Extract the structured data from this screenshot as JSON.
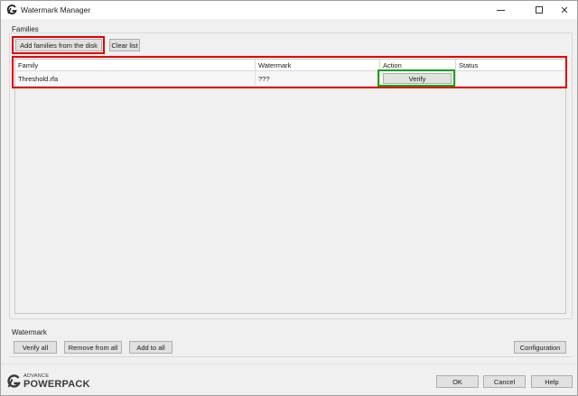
{
  "window": {
    "title": "Watermark Manager",
    "minimize_icon": "minimize-icon",
    "maximize_icon": "maximize-icon",
    "close_icon": "close-icon",
    "close_glyph": "✕"
  },
  "families": {
    "group_label": "Families",
    "add_button": "Add families from the disk",
    "clear_button": "Clear list",
    "table": {
      "columns": [
        "Family",
        "Watermark",
        "Action",
        "Status"
      ],
      "rows": [
        {
          "family": "Threshold.rfa",
          "watermark": "???",
          "action": "Verify",
          "status": ""
        }
      ]
    }
  },
  "watermark": {
    "group_label": "Watermark",
    "verify_all": "Verify all",
    "remove_from_all": "Remove from all",
    "add_to_all": "Add to all",
    "configuration": "Configuration"
  },
  "footer": {
    "logo_advance": "ADVANCE",
    "logo_powerpack": "POWERPACK",
    "ok": "OK",
    "cancel": "Cancel",
    "help": "Help"
  },
  "highlights": {
    "red": "#e00000",
    "green": "#1aa01a"
  }
}
